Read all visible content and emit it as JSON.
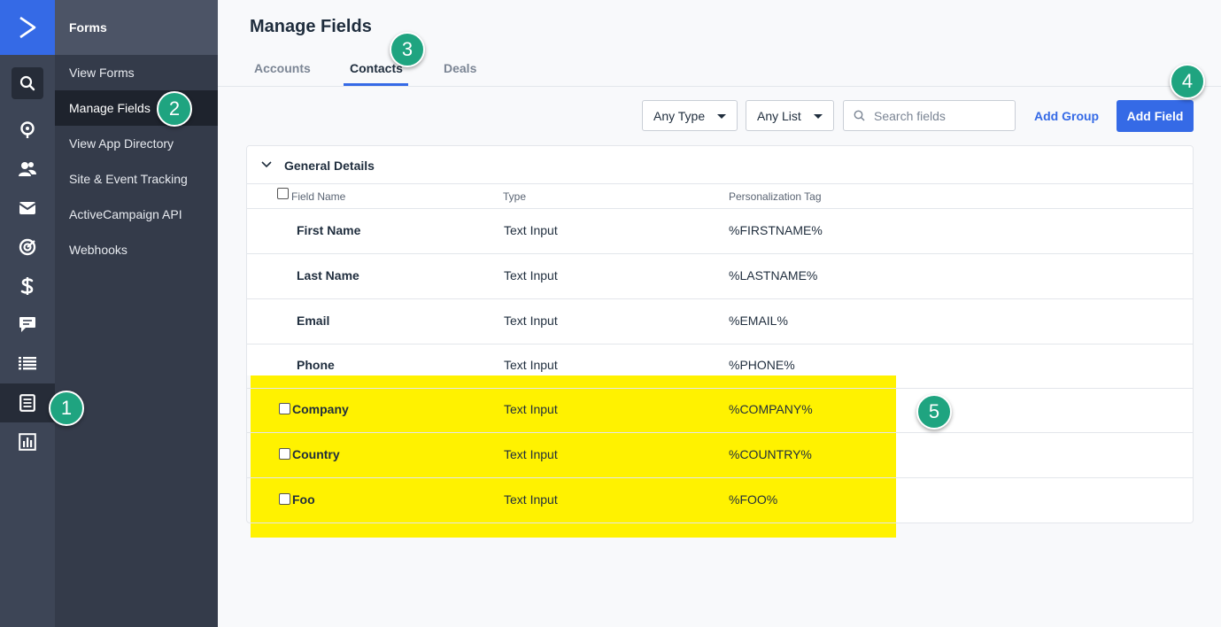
{
  "sidebar": {
    "section_title": "Forms",
    "items": [
      {
        "label": "View Forms"
      },
      {
        "label": "Manage Fields"
      },
      {
        "label": "View App Directory"
      },
      {
        "label": "Site & Event Tracking"
      },
      {
        "label": "ActiveCampaign API"
      },
      {
        "label": "Webhooks"
      }
    ]
  },
  "rail_icons": [
    "logo-chevron-icon",
    "search-icon",
    "location-pin-icon",
    "contacts-icon",
    "envelope-icon",
    "target-icon",
    "dollar-icon",
    "chat-icon",
    "list-icon",
    "forms-icon",
    "bar-chart-icon"
  ],
  "header": {
    "title": "Manage Fields",
    "tabs": [
      {
        "label": "Accounts"
      },
      {
        "label": "Contacts"
      },
      {
        "label": "Deals"
      }
    ]
  },
  "toolbar": {
    "type_filter": "Any Type",
    "list_filter": "Any List",
    "search_placeholder": "Search fields",
    "add_group_label": "Add Group",
    "add_field_label": "Add Field"
  },
  "table": {
    "group_title": "General Details",
    "columns": [
      "Field Name",
      "Type",
      "Personalization Tag"
    ],
    "rows": [
      {
        "name": "First Name",
        "type": "Text Input",
        "tag": "%FIRSTNAME%"
      },
      {
        "name": "Last Name",
        "type": "Text Input",
        "tag": "%LASTNAME%"
      },
      {
        "name": "Email",
        "type": "Text Input",
        "tag": "%EMAIL%"
      },
      {
        "name": "Phone",
        "type": "Text Input",
        "tag": "%PHONE%"
      },
      {
        "name": "Company",
        "type": "Text Input",
        "tag": "%COMPANY%"
      },
      {
        "name": "Country",
        "type": "Text Input",
        "tag": "%COUNTRY%"
      },
      {
        "name": "Foo",
        "type": "Text Input",
        "tag": "%FOO%"
      }
    ]
  },
  "callouts": [
    "1",
    "2",
    "3",
    "4",
    "5"
  ],
  "colors": {
    "brand_blue": "#356ae6",
    "callout_green": "#1fa480",
    "highlight_yellow": "#fff200",
    "rail_bg": "#3d4556",
    "subnav_bg": "#343b4a"
  }
}
